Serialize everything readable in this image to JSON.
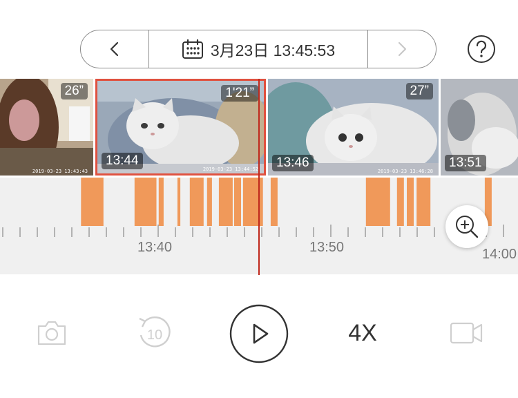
{
  "date_nav": {
    "date_time": "3月23日 13:45:53"
  },
  "thumbnails": [
    {
      "duration": "26”",
      "time": "",
      "stamp": "2019-03-23 13:43:43"
    },
    {
      "duration": "1'21”",
      "time": "13:44",
      "stamp": "2019-03-23 13:44:52"
    },
    {
      "duration": "27”",
      "time": "13:46",
      "stamp": "2019-03-23 13:46:28"
    },
    {
      "duration": "",
      "time": "13:51",
      "stamp": ""
    }
  ],
  "timeline": {
    "labels": [
      "13:40",
      "13:50",
      "14:00"
    ],
    "segments": [
      {
        "start": "13:35:32",
        "end": "13:36:50"
      },
      {
        "start": "13:38:38",
        "end": "13:39:54"
      },
      {
        "start": "13:40:02",
        "end": "13:40:19"
      },
      {
        "start": "13:41:07",
        "end": "13:41:17"
      },
      {
        "start": "13:41:50",
        "end": "13:42:38"
      },
      {
        "start": "13:42:50",
        "end": "13:43:07"
      },
      {
        "start": "13:43:31",
        "end": "13:44:19"
      },
      {
        "start": "13:44:24",
        "end": "13:44:48"
      },
      {
        "start": "13:44:55",
        "end": "13:46:04"
      },
      {
        "start": "13:46:31",
        "end": "13:46:55"
      },
      {
        "start": "13:52:02",
        "end": "13:53:26"
      },
      {
        "start": "13:53:50",
        "end": "13:54:14"
      },
      {
        "start": "13:54:24",
        "end": "13:54:48"
      },
      {
        "start": "13:54:58",
        "end": "13:55:46"
      },
      {
        "start": "13:58:55",
        "end": "13:59:19"
      }
    ],
    "current_time": "13:45:53"
  },
  "controls": {
    "rewind_seconds": "10",
    "speed": "4X"
  },
  "colors": {
    "accent": "#e0513f",
    "segment": "#f0995a",
    "playhead": "#c0281c"
  }
}
